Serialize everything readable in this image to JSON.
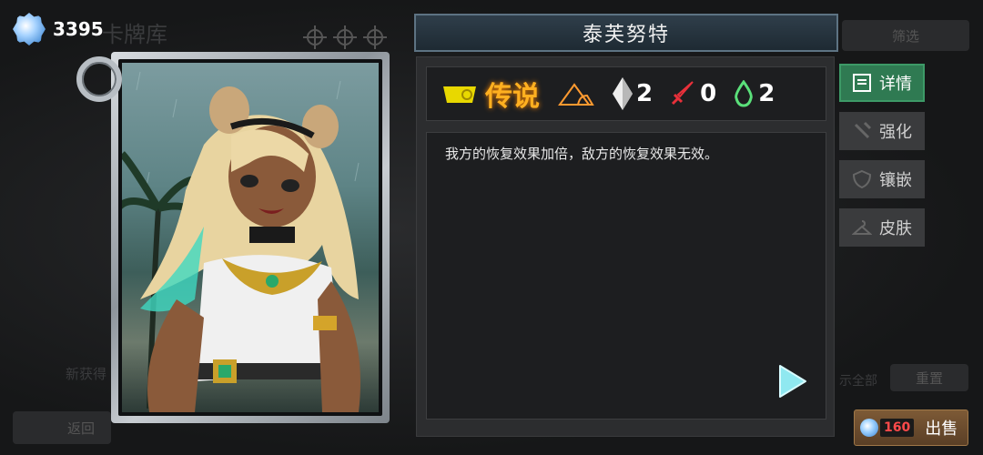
{
  "currency": {
    "amount": "3395",
    "icon": "crystal-icon"
  },
  "background": {
    "title": "卡牌库",
    "filter": "筛选",
    "new_label": "新获得",
    "back": "返回",
    "show_all": "示全部",
    "reset": "重置"
  },
  "card": {
    "name": "泰芙努特",
    "rarity": "传说",
    "stats": {
      "crystal": "2",
      "attack": "0",
      "drop": "2"
    },
    "description": "我方的恢复效果加倍，敌方的恢复效果无效。"
  },
  "side_menu": [
    {
      "label": "详情",
      "active": true
    },
    {
      "label": "强化",
      "active": false
    },
    {
      "label": "镶嵌",
      "active": false
    },
    {
      "label": "皮肤",
      "active": false
    }
  ],
  "sell": {
    "price": "160",
    "label": "出售"
  }
}
